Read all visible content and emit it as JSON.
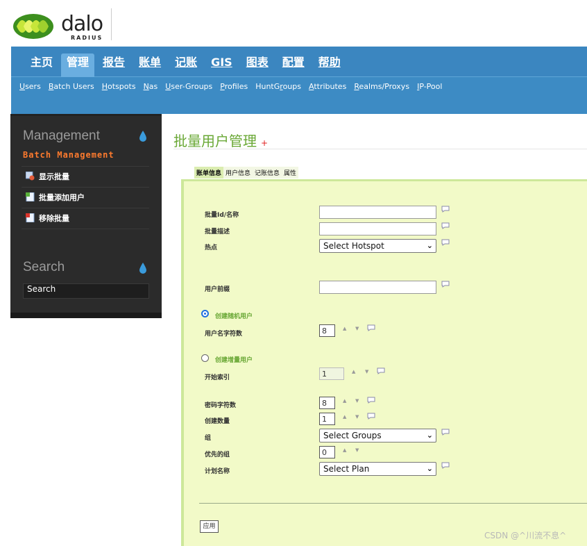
{
  "logo": {
    "text": "dalo",
    "sub": "RADIUS"
  },
  "main_nav": [
    {
      "label": "主页"
    },
    {
      "label": "管理"
    },
    {
      "label": "报告"
    },
    {
      "label": "账单"
    },
    {
      "label": "记账"
    },
    {
      "label": "GIS"
    },
    {
      "label": "图表"
    },
    {
      "label": "配置"
    },
    {
      "label": "帮助"
    }
  ],
  "sub_nav": [
    {
      "label": "Users"
    },
    {
      "label": "Batch Users"
    },
    {
      "label": "Hotspots"
    },
    {
      "label": "Nas"
    },
    {
      "label": "User-Groups"
    },
    {
      "label": "Profiles"
    },
    {
      "label": "HuntGroups"
    },
    {
      "label": "Attributes"
    },
    {
      "label": "Realms/Proxys"
    },
    {
      "label": "IP-Pool"
    }
  ],
  "sidebar": {
    "management_title": "Management",
    "management_sub": "Batch Management",
    "items": [
      {
        "label": "显示批量"
      },
      {
        "label": "批量添加用户"
      },
      {
        "label": "移除批量"
      }
    ],
    "search_title": "Search",
    "search_value": "Search"
  },
  "page": {
    "title": "批量用户管理",
    "plus": "+",
    "tabs": [
      {
        "label": "账单信息"
      },
      {
        "label": "用户信息"
      },
      {
        "label": "记账信息"
      },
      {
        "label": "属性"
      }
    ]
  },
  "form": {
    "batch_id_label": "批量Id/名称",
    "batch_desc_label": "批量描述",
    "hotspot_label": "热点",
    "hotspot_selected": "Select Hotspot",
    "user_prefix_label": "用户前缀",
    "random_radio_label": "创建随机用户",
    "username_length_label": "用户名字符数",
    "username_length_value": "8",
    "incremental_radio_label": "创建增量用户",
    "start_index_label": "开始索引",
    "start_index_value": "1",
    "password_length_label": "密码字符数",
    "password_length_value": "8",
    "create_count_label": "创建数量",
    "create_count_value": "1",
    "group_label": "组",
    "group_selected": "Select Groups",
    "group_priority_label": "优先的组",
    "group_priority_value": "0",
    "plan_label": "计划名称",
    "plan_selected": "Select Plan",
    "apply_label": "应用"
  },
  "watermark": "CSDN @^川流不息^",
  "colors": {
    "nav_blue": "#3b86c0",
    "active_tab": "#6aaee0",
    "title_green": "#6aa836",
    "form_bg": "#f2fac8",
    "sidebar_bg": "#2b2b2b",
    "accent_orange": "#ff7b2e"
  }
}
